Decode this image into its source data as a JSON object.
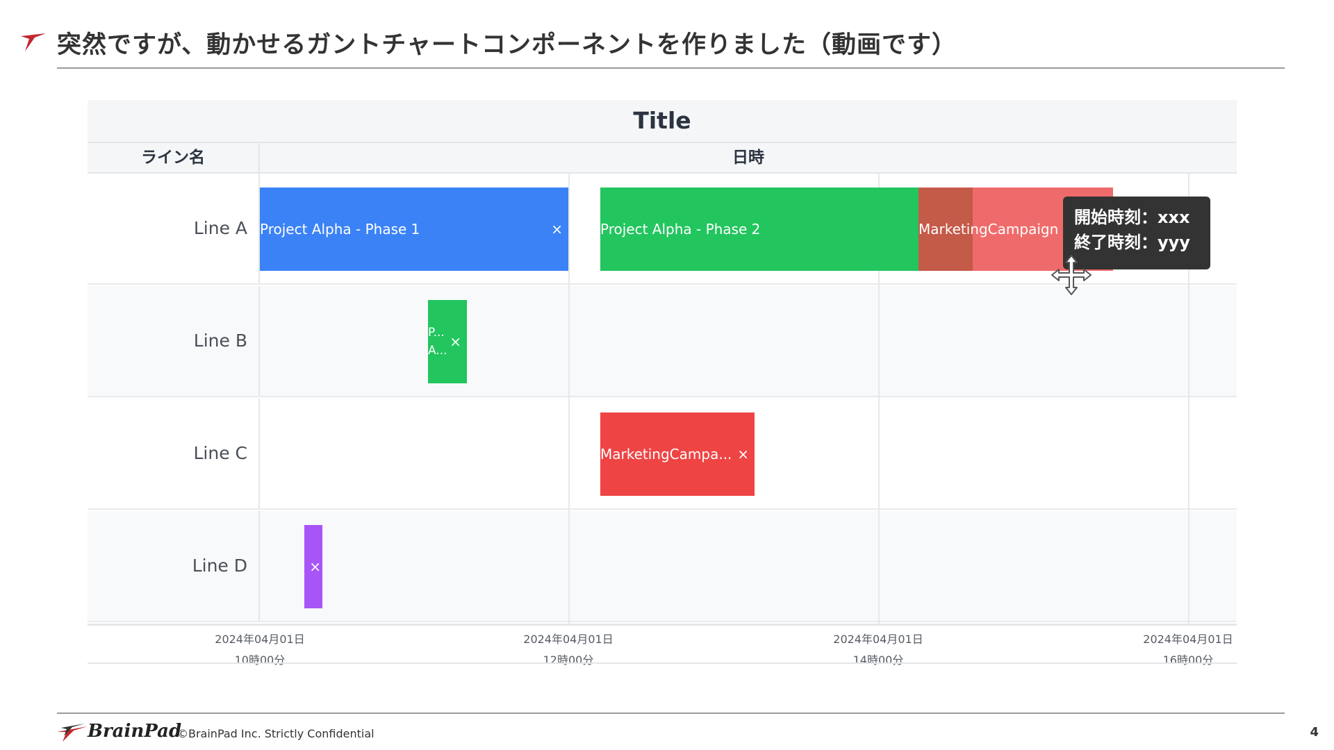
{
  "slide": {
    "title": "突然ですが、動かせるガントチャートコンポーネントを作りました（動画です）",
    "page_number": "4"
  },
  "footer": {
    "brand": "BrainPad",
    "copyright": "©BrainPad Inc.  Strictly Confidential"
  },
  "gantt": {
    "title": "Title",
    "col_line": "ライン名",
    "col_time": "日時",
    "rows": [
      {
        "label": "Line A"
      },
      {
        "label": "Line B"
      },
      {
        "label": "Line C"
      },
      {
        "label": "Line D"
      }
    ],
    "ticks": [
      {
        "date": "2024年04月01日",
        "time": "10時00分"
      },
      {
        "date": "2024年04月01日",
        "time": "12時00分"
      },
      {
        "date": "2024年04月01日",
        "time": "14時00分"
      },
      {
        "date": "2024年04月01日",
        "time": "16時00分"
      }
    ],
    "bars": [
      {
        "label": "Project Alpha - Phase 1",
        "close": "×",
        "color": "#3b82f6"
      },
      {
        "label": "Project Alpha - Phase 2",
        "close": "",
        "color": "#22c55e"
      },
      {
        "label": "MarketingCampaign",
        "close": "",
        "color": "#ef4444"
      },
      {
        "label": "P...\nA...",
        "close": "×",
        "color": "#22c55e"
      },
      {
        "label": "MarketingCampa...",
        "close": "×",
        "color": "#ef4444"
      },
      {
        "label": "",
        "close": "×",
        "color": "#a855f7"
      }
    ],
    "tooltip": {
      "line1": "開始時刻：xxx",
      "line2": "終了時刻：yyy"
    }
  },
  "colors": {
    "brand_red": "#c0282d",
    "blue": "#3b82f6",
    "green": "#22c55e",
    "red": "#ef4444",
    "purple": "#a855f7"
  }
}
